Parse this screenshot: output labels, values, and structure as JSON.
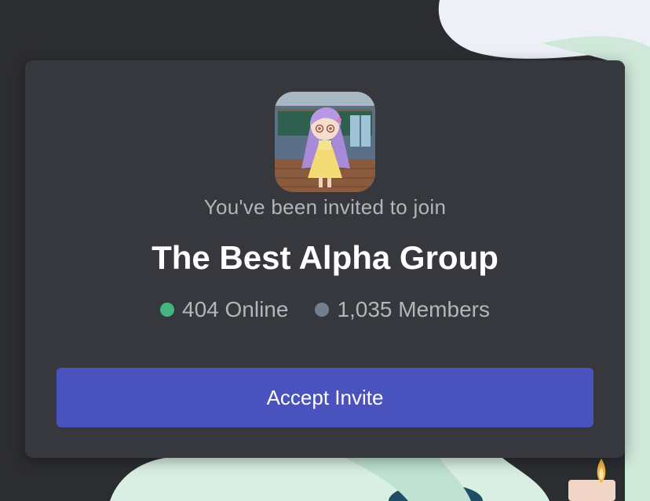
{
  "invite": {
    "prompt": "You've been invited to join",
    "guild_name": "The Best Alpha Group",
    "online_count": "404 Online",
    "member_count": "1,035 Members",
    "accept_label": "Accept Invite"
  },
  "colors": {
    "accent": "#4a52be",
    "online": "#43b581",
    "offline": "#747f8d",
    "card": "#36383d",
    "background": "#2c2d31"
  },
  "icons": {
    "guild": "anime-girl-avatar",
    "online": "online-status-dot",
    "members": "members-status-dot"
  }
}
